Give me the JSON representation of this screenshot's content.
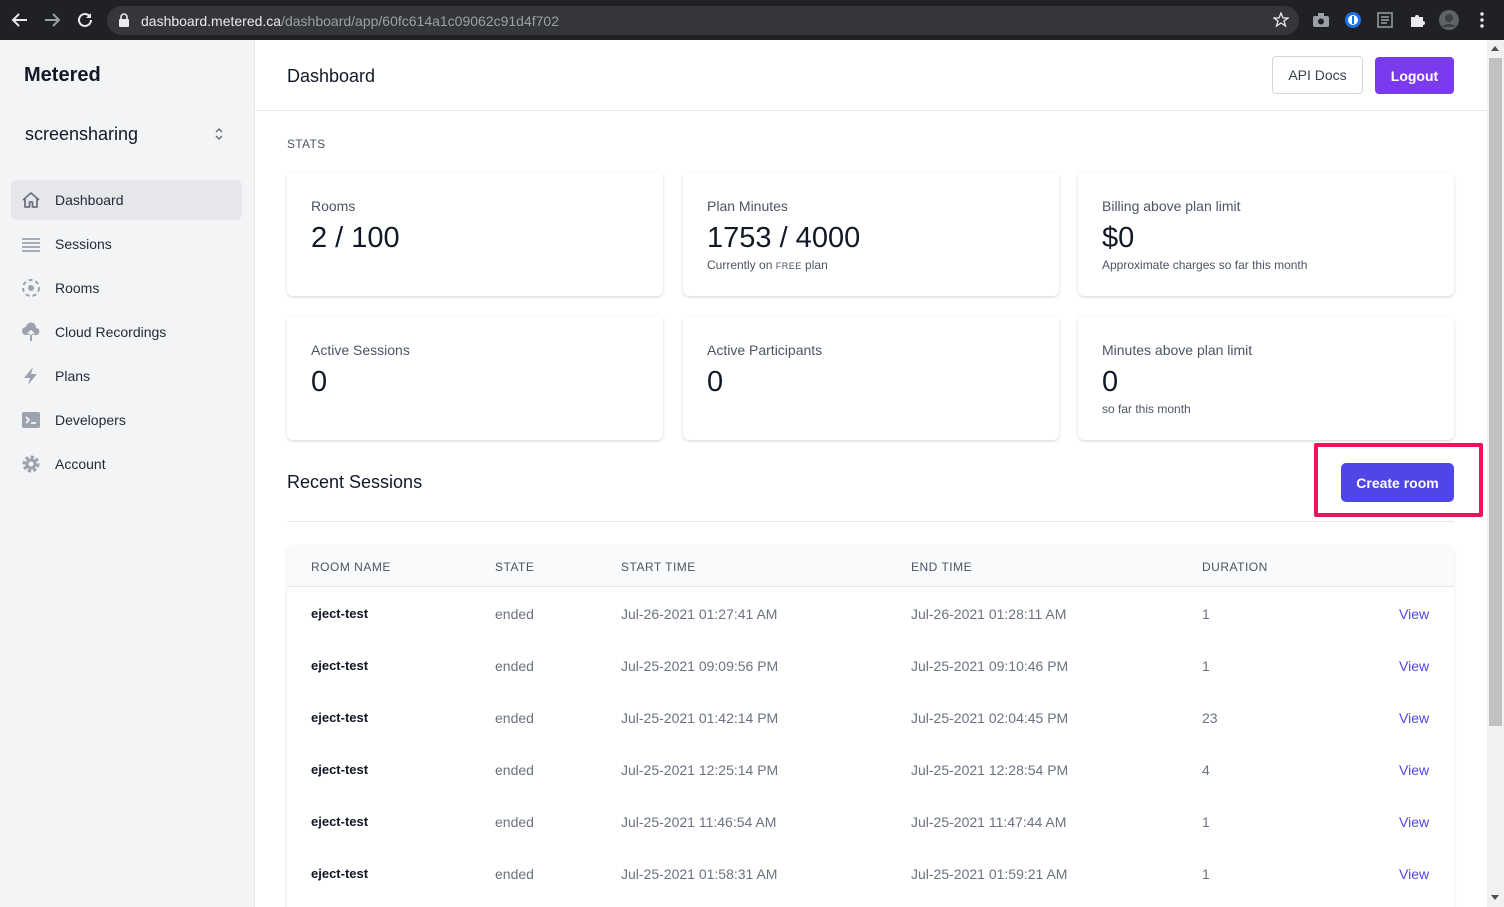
{
  "browser": {
    "url_host": "dashboard.metered.ca",
    "url_path": "/dashboard/app/60fc614a1c09062c91d4f702"
  },
  "sidebar": {
    "brand": "Metered",
    "app_name": "screensharing",
    "items": [
      {
        "label": "Dashboard",
        "icon": "home-icon",
        "active": true
      },
      {
        "label": "Sessions",
        "icon": "list-icon",
        "active": false
      },
      {
        "label": "Rooms",
        "icon": "rooms-icon",
        "active": false
      },
      {
        "label": "Cloud Recordings",
        "icon": "cloud-upload-icon",
        "active": false
      },
      {
        "label": "Plans",
        "icon": "lightning-icon",
        "active": false
      },
      {
        "label": "Developers",
        "icon": "terminal-icon",
        "active": false
      },
      {
        "label": "Account",
        "icon": "gear-icon",
        "active": false
      }
    ]
  },
  "header": {
    "title": "Dashboard",
    "api_docs": "API Docs",
    "logout": "Logout"
  },
  "stats": {
    "label": "STATS",
    "cards": [
      {
        "label": "Rooms",
        "value": "2 / 100",
        "sub_pre": "",
        "sub_sc": "",
        "sub_post": ""
      },
      {
        "label": "Plan Minutes",
        "value": "1753 / 4000",
        "sub_pre": "Currently on ",
        "sub_sc": "FREE",
        "sub_post": " plan"
      },
      {
        "label": "Billing above plan limit",
        "value": "$0",
        "sub_pre": "Approximate charges so far this month",
        "sub_sc": "",
        "sub_post": ""
      },
      {
        "label": "Active Sessions",
        "value": "0",
        "sub_pre": "",
        "sub_sc": "",
        "sub_post": ""
      },
      {
        "label": "Active Participants",
        "value": "0",
        "sub_pre": "",
        "sub_sc": "",
        "sub_post": ""
      },
      {
        "label": "Minutes above plan limit",
        "value": "0",
        "sub_pre": "so far this month",
        "sub_sc": "",
        "sub_post": ""
      }
    ]
  },
  "recent": {
    "title": "Recent Sessions",
    "create_button": "Create room",
    "columns": [
      "ROOM NAME",
      "STATE",
      "START TIME",
      "END TIME",
      "DURATION"
    ],
    "rows": [
      {
        "room": "eject-test",
        "state": "ended",
        "start": "Jul-26-2021 01:27:41 AM",
        "end": "Jul-26-2021 01:28:11 AM",
        "duration": "1",
        "action": "View"
      },
      {
        "room": "eject-test",
        "state": "ended",
        "start": "Jul-25-2021 09:09:56 PM",
        "end": "Jul-25-2021 09:10:46 PM",
        "duration": "1",
        "action": "View"
      },
      {
        "room": "eject-test",
        "state": "ended",
        "start": "Jul-25-2021 01:42:14 PM",
        "end": "Jul-25-2021 02:04:45 PM",
        "duration": "23",
        "action": "View"
      },
      {
        "room": "eject-test",
        "state": "ended",
        "start": "Jul-25-2021 12:25:14 PM",
        "end": "Jul-25-2021 12:28:54 PM",
        "duration": "4",
        "action": "View"
      },
      {
        "room": "eject-test",
        "state": "ended",
        "start": "Jul-25-2021 11:46:54 AM",
        "end": "Jul-25-2021 11:47:44 AM",
        "duration": "1",
        "action": "View"
      },
      {
        "room": "eject-test",
        "state": "ended",
        "start": "Jul-25-2021 01:58:31 AM",
        "end": "Jul-25-2021 01:59:21 AM",
        "duration": "1",
        "action": "View"
      }
    ]
  },
  "colors": {
    "logout": "#7c3aed",
    "create": "#4f46e5",
    "highlight": "#ec135a",
    "view_link": "#4f46e5"
  }
}
